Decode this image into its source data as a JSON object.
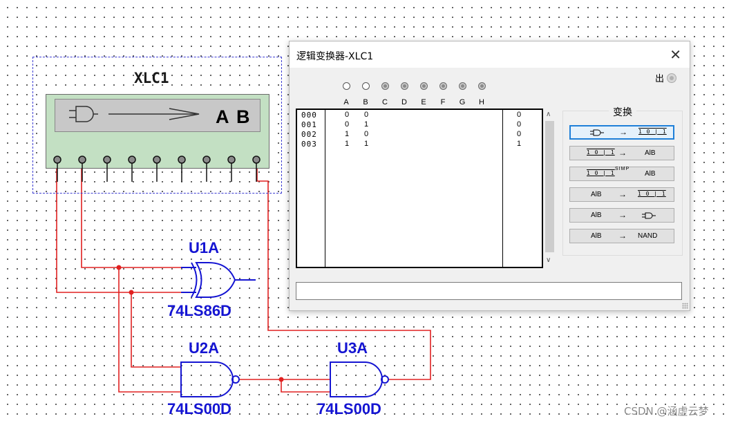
{
  "schematic": {
    "analyzer": {
      "refdes": "XLC1",
      "display_text": "A B",
      "pins": 9
    },
    "gates": [
      {
        "refdes": "U1A",
        "part": "74LS86D",
        "type": "XOR"
      },
      {
        "refdes": "U2A",
        "part": "74LS00D",
        "type": "NAND"
      },
      {
        "refdes": "U3A",
        "part": "74LS00D",
        "type": "NAND"
      }
    ],
    "wire_color": "#e02020",
    "gate_color": "#1414d2"
  },
  "window": {
    "title": "逻辑变换器-XLC1",
    "close_glyph": "✕",
    "output_label": "出",
    "input_columns": [
      "A",
      "B",
      "C",
      "D",
      "E",
      "F",
      "G",
      "H"
    ],
    "truth_table": {
      "rows": [
        {
          "index": "000",
          "inputs": [
            "0",
            "0"
          ],
          "output": "0"
        },
        {
          "index": "001",
          "inputs": [
            "0",
            "1"
          ],
          "output": "0"
        },
        {
          "index": "002",
          "inputs": [
            "1",
            "0"
          ],
          "output": "0"
        },
        {
          "index": "003",
          "inputs": [
            "1",
            "1"
          ],
          "output": "1"
        }
      ]
    },
    "conversion": {
      "title": "变换",
      "buttons": [
        {
          "from": "circuit-icon",
          "arrow": "→",
          "to": "1 0 | 1",
          "from_text": "",
          "to_text": "",
          "active": true
        },
        {
          "from": "",
          "arrow": "→",
          "to": "",
          "from_text": "1 0 | 1",
          "to_text": "AlB",
          "active": false
        },
        {
          "from": "",
          "arrow": "SIMP",
          "to": "",
          "from_text": "1 0 | 1",
          "to_text": "AlB",
          "active": false
        },
        {
          "from": "",
          "arrow": "→",
          "to": "",
          "from_text": "AlB",
          "to_text": "1 0 | 1",
          "active": false
        },
        {
          "from": "",
          "arrow": "→",
          "to": "circuit-icon",
          "from_text": "AlB",
          "to_text": "",
          "active": false
        },
        {
          "from": "",
          "arrow": "→",
          "to": "",
          "from_text": "AlB",
          "to_text": "NAND",
          "active": false
        }
      ]
    },
    "expression_value": ""
  },
  "watermark": "CSDN @涵虚云梦"
}
